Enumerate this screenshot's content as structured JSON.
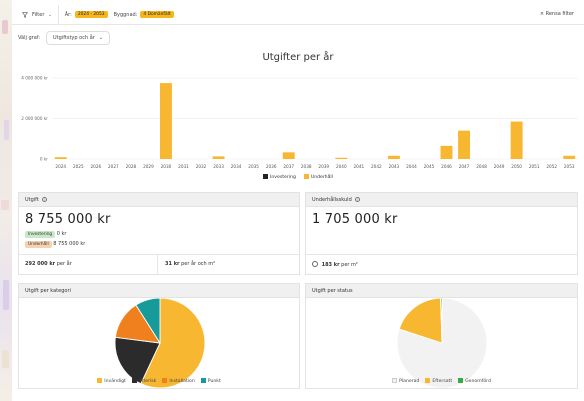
{
  "filter": {
    "label": "Filter",
    "year_label": "År:",
    "year_value": "2024 - 2053",
    "building_label": "Byggnad:",
    "building_value": "4 Domänfält",
    "clear_label": "× Rensa filter"
  },
  "graph_select": {
    "label": "Välj graf:",
    "value": "Utgiftstyp och år"
  },
  "chart_data": {
    "type": "bar",
    "title": "Utgifter per år",
    "ytick_labels": [
      "4 000 000 kr",
      "2 000 000 kr",
      "0 kr"
    ],
    "yticks": [
      4000000,
      2000000,
      0
    ],
    "ylim": [
      0,
      4200000
    ],
    "categories": [
      "2024",
      "2025",
      "2026",
      "2027",
      "2028",
      "2029",
      "2030",
      "2031",
      "2032",
      "2033",
      "2034",
      "2035",
      "2036",
      "2037",
      "2038",
      "2039",
      "2040",
      "2041",
      "2042",
      "2043",
      "2044",
      "2045",
      "2046",
      "2047",
      "2048",
      "2049",
      "2050",
      "2051",
      "2052",
      "2053"
    ],
    "series": [
      {
        "name": "Investering",
        "color": "#222222",
        "values": [
          0,
          0,
          0,
          0,
          0,
          0,
          0,
          0,
          0,
          0,
          0,
          0,
          0,
          0,
          0,
          0,
          0,
          0,
          0,
          0,
          0,
          0,
          0,
          0,
          0,
          0,
          0,
          0,
          0,
          0
        ]
      },
      {
        "name": "Underhåll",
        "color": "#f7b731",
        "values": [
          90000,
          0,
          0,
          0,
          0,
          0,
          3750000,
          0,
          0,
          130000,
          0,
          0,
          0,
          330000,
          0,
          0,
          60000,
          0,
          0,
          160000,
          0,
          0,
          650000,
          1400000,
          0,
          0,
          1850000,
          0,
          0,
          160000
        ]
      }
    ]
  },
  "legend": {
    "investering": "Investering",
    "underhall": "Underhåll"
  },
  "utgift_card": {
    "title": "Utgift",
    "total": "8 755 000 kr",
    "inv_tag": "Investering",
    "inv_value": "0 kr",
    "und_tag": "Underhåll",
    "und_value": "8 755 000 kr",
    "per_year_value": "292 000 kr",
    "per_year_label": "per år",
    "per_m2_value": "31 kr",
    "per_m2_label": "per år och m²"
  },
  "skuld_card": {
    "title": "Underhållsskuld",
    "total": "1 705 000 kr",
    "per_m2_value": "183 kr",
    "per_m2_label": "per m²"
  },
  "kategori_card": {
    "title": "Utgift per kategori",
    "slices": [
      {
        "label": "Invändigt",
        "value": 57,
        "color": "#f7b731"
      },
      {
        "label": "Ytterlsk",
        "value": 20,
        "color": "#2b2b2b"
      },
      {
        "label": "Installation",
        "value": 14,
        "color": "#f07f1e"
      },
      {
        "label": "Punkt",
        "value": 9,
        "color": "#179a9a"
      }
    ]
  },
  "status_card": {
    "title": "Utgift per status",
    "slices": [
      {
        "label": "Planerad",
        "value": 80,
        "color": "#f2f2f2"
      },
      {
        "label": "Eftersatt",
        "value": 19.5,
        "color": "#f7b731"
      },
      {
        "label": "Genomförd",
        "value": 0.5,
        "color": "#39a845"
      }
    ]
  }
}
